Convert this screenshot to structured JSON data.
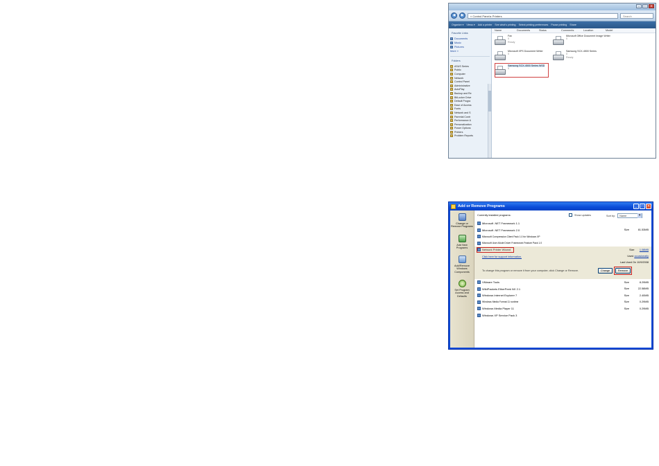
{
  "printers_window": {
    "nav_buttons": [
      "◀",
      "▶"
    ],
    "address": "« Control Panel ▸ Printers",
    "search_placeholder": "Search",
    "window_controls": [
      "–",
      "□",
      "✕"
    ],
    "toolbar": [
      "Organize ▾",
      "Views ▾",
      "Add a printer",
      "See what's printing",
      "Select printing preferences",
      "Pause printing",
      "Share"
    ],
    "nav_header": "Favorite Links",
    "favorite_links": [
      "Documents",
      "Music",
      "Pictures",
      "More »"
    ],
    "folders_header": "Folders",
    "folders": [
      "ASUS Series",
      "Public",
      "Computer",
      "Network",
      "Control Panel",
      "Administrative",
      "AutoPlay",
      "Backup and Re",
      "BitLocker Drive",
      "Default Progra",
      "Ease of Access",
      "Fonts",
      "Network and S",
      "Parental Contr",
      "Performance &",
      "Personalization",
      "Power Options",
      "Printers",
      "Problem Reports"
    ],
    "columns": [
      "Name",
      "Documents",
      "Status",
      "Comments",
      "Location",
      "Model"
    ],
    "printers": [
      {
        "name": "Fax",
        "count": "0",
        "status": "Ready"
      },
      {
        "name": "Microsoft Office Document Image Writer",
        "count": "0",
        "status": ""
      },
      {
        "name": "Microsoft XPS Document Writer",
        "count": "0",
        "status": ""
      },
      {
        "name": "Samsung SCX-4500 Series",
        "count": "0",
        "status": "Ready"
      },
      {
        "name": "Samsung SCX-4500 Series WSD",
        "count": "0",
        "status": ""
      }
    ]
  },
  "arp_window": {
    "title": "Add or Remove Programs",
    "window_controls": [
      "_",
      "□",
      "✕"
    ],
    "sidebar": [
      {
        "label": "Change or Remove Programs"
      },
      {
        "label": "Add New Programs"
      },
      {
        "label": "Add/Remove Windows Components"
      },
      {
        "label": "Set Program Access and Defaults"
      }
    ],
    "currently_installed": "Currently installed programs:",
    "show_updates": "Show updates",
    "sort_by_label": "Sort by:",
    "sort_by_value": "Name",
    "programs_before": [
      {
        "name": "Microsoft .NET Framework 1.1",
        "size_label": "",
        "size": ""
      },
      {
        "name": "Microsoft .NET Framework 2.0",
        "size_label": "Size",
        "size": "81.53MB"
      },
      {
        "name": "Microsoft Compression Client Pack 1.0 for Windows XP",
        "size_label": "",
        "size": ""
      },
      {
        "name": "Microsoft User-Mode Driver Framework Feature Pack 1.0",
        "size_label": "",
        "size": ""
      }
    ],
    "selected_program": {
      "name": "Network Printer Wizard",
      "support_link": "Click here for support information.",
      "size_label": "Size",
      "size": "1.08MB",
      "used_label": "Used",
      "used": "occasionally",
      "last_used": "Last Used On 10/9/2008",
      "change_text": "To change this program or remove it from your computer, click Change or Remove.",
      "change_button": "Change",
      "remove_button": "Remove"
    },
    "programs_after": [
      {
        "name": "VMware Tools",
        "size_label": "Size",
        "size": "8.29MB"
      },
      {
        "name": "WildPackets EtherPeek NX 2.1",
        "size_label": "Size",
        "size": "22.58MB"
      },
      {
        "name": "Windows Internet Explorer 7",
        "size_label": "Size",
        "size": "2.40MB"
      },
      {
        "name": "Windows Media Format 11 runtime",
        "size_label": "Size",
        "size": "0.29MB"
      },
      {
        "name": "Windows Media Player 11",
        "size_label": "Size",
        "size": "0.29MB"
      },
      {
        "name": "Windows XP Service Pack 3",
        "size_label": "",
        "size": ""
      }
    ]
  }
}
